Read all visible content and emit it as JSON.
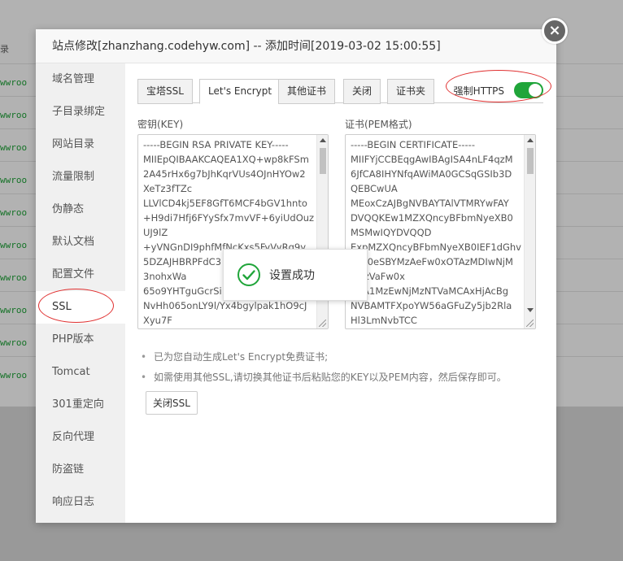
{
  "background": {
    "row_cut_label_top": "录",
    "row_cut_label": "wwroo",
    "row_count": 10
  },
  "modal": {
    "title": "站点修改[zhanzhang.codehyw.com] -- 添加时间[2019-03-02 15:00:55]",
    "close_icon": "×"
  },
  "sidebar": {
    "items": [
      {
        "label": "域名管理"
      },
      {
        "label": "子目录绑定"
      },
      {
        "label": "网站目录"
      },
      {
        "label": "流量限制"
      },
      {
        "label": "伪静态"
      },
      {
        "label": "默认文档"
      },
      {
        "label": "配置文件"
      },
      {
        "label": "SSL"
      },
      {
        "label": "PHP版本"
      },
      {
        "label": "Tomcat"
      },
      {
        "label": "301重定向"
      },
      {
        "label": "反向代理"
      },
      {
        "label": "防盗链"
      },
      {
        "label": "响应日志"
      }
    ],
    "active": "SSL"
  },
  "tabs": [
    {
      "label": "宝塔SSL"
    },
    {
      "label": "Let's Encrypt"
    },
    {
      "label": "其他证书"
    },
    {
      "label": "关闭"
    },
    {
      "label": "证书夹"
    }
  ],
  "active_tab": "Let's Encrypt",
  "force_https": {
    "label": "强制HTTPS",
    "enabled": true
  },
  "key_pane": {
    "label": "密钥(KEY)",
    "value": "-----BEGIN RSA PRIVATE KEY-----\nMIIEpQIBAAKCAQEA1XQ+wp8kFSm\n2A45rHx6g7bJhKqrVUs4OJnHYOw2\nXeTz3fTZc\nLLVlCD4kj5EF8GfT6MCF4bGV1hnto\n+H9di7Hfj6FYySfx7mvVF+6yiUdOuz\nUJ9lZ\n+yVNGnDI9phfMfNcKxs5FyVyRq9y\n5DZAJHBRPFdC3\n3nohxWa\n65o9YHTguGcrSi\nNvHh065onLY9l/Yx4bgylpak1hO9cJ\nXyu7F"
  },
  "cert_pane": {
    "label": "证书(PEM格式)",
    "value": "-----BEGIN CERTIFICATE-----\nMIIFYjCCBEqgAwIBAgISA4nLF4qzM\n6JfCA8IHYNfqAWiMA0GCSqGSIb3D\nQEBCwUA\nMEoxCzAJBgNVBAYTAlVTMRYwFAY\nDVQQKEw1MZXQncyBFbmNyeXB0\nMSMwIQYDVQQD\nExpMZXQncyBFbmNyeXB0IEF1dGhv\ncml0eSBYMzAeFw0xOTAzMDIwNjM\nxMzVaFw0x\nOTA1MzEwNjMzNTVaMCAxHjAcBg\nNVBAMTFXpoYW56aGFuZy5jb2Rla\nHl3LmNvbTCC"
  },
  "tips": [
    "已为您自动生成Let's Encrypt免费证书;",
    "如需使用其他SSL,请切换其他证书后粘贴您的KEY以及PEM内容，然后保存即可。"
  ],
  "close_ssl_button": "关闭SSL",
  "toast": {
    "message": "设置成功",
    "icon": "check-circle-icon"
  },
  "colors": {
    "accent_green": "#20a53a",
    "annotation_red": "#e03030"
  }
}
